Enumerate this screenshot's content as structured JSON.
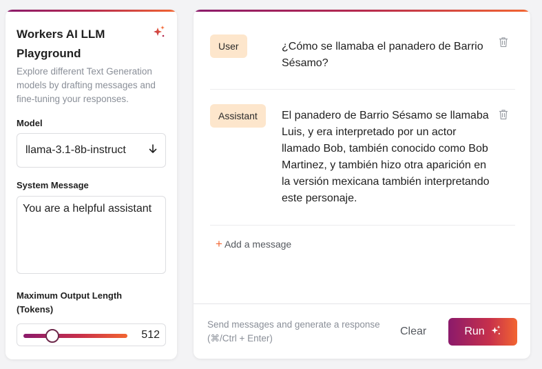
{
  "sidebar": {
    "title": "Workers AI LLM Playground",
    "description": "Explore different Text Generation models by drafting messages and fine-tuning your responses.",
    "model_label": "Model",
    "model_value": "llama-3.1-8b-instruct",
    "system_label": "System Message",
    "system_value": "You are a helpful assistant",
    "max_len_label": "Maximum Output Length (Tokens)",
    "max_len_value": "512",
    "slider_fraction": 0.28
  },
  "messages": [
    {
      "role": "User",
      "text": "¿Cómo se llamaba el panadero de Barrio Sésamo?"
    },
    {
      "role": "Assistant",
      "text": "El panadero de Barrio Sésamo se llamaba Luis, y era interpretado por un actor llamado Bob, también conocido como Bob Martinez, y también hizo otra aparición en la versión mexicana también interpretando este personaje."
    }
  ],
  "add_message_label": "Add a message",
  "footer": {
    "hint": "Send messages and generate a response (⌘/Ctrl + Enter)",
    "clear_label": "Clear",
    "run_label": "Run"
  },
  "colors": {
    "accent_start": "#8b1a6b",
    "accent_end": "#f26531",
    "role_badge": "#fde6cc"
  },
  "icons": [
    "sparkle-icon",
    "arrow-down-icon",
    "trash-icon",
    "plus-icon"
  ]
}
